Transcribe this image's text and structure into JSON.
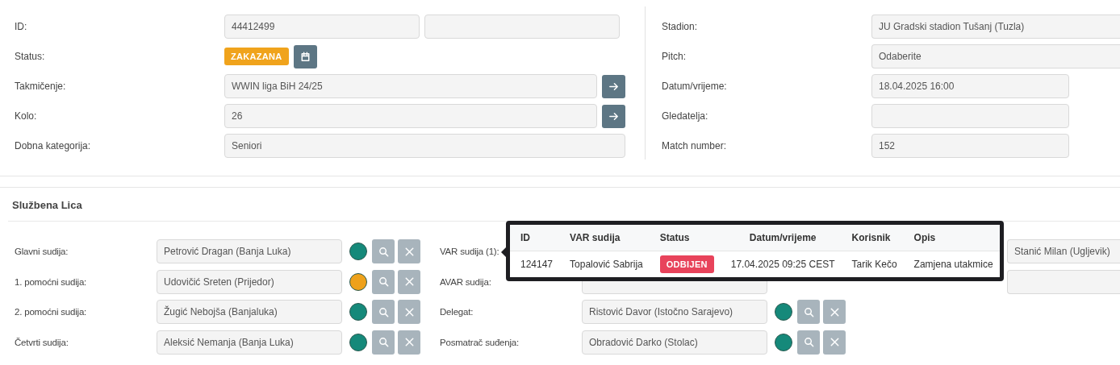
{
  "match": {
    "left": [
      {
        "kind": "double",
        "label": "ID:",
        "value": "44412499"
      },
      {
        "kind": "status",
        "label": "Status:",
        "badge": "ZAKAZANA"
      },
      {
        "kind": "link",
        "label": "Takmičenje:",
        "value": "WWIN liga BiH 24/25"
      },
      {
        "kind": "link",
        "label": "Kolo:",
        "value": "26"
      },
      {
        "kind": "plain",
        "label": "Dobna kategorija:",
        "value": "Seniori"
      }
    ],
    "right": [
      {
        "kind": "wide",
        "label": "Stadion:",
        "value": "JU Gradski stadion Tušanj (Tuzla)"
      },
      {
        "kind": "wide",
        "label": "Pitch:",
        "value": "Odaberite"
      },
      {
        "kind": "plain",
        "label": "Datum/vrijeme:",
        "value": "18.04.2025 16:00"
      },
      {
        "kind": "plain",
        "label": "Gledatelja:"
      },
      {
        "kind": "plain",
        "label": "Match number:",
        "value": "152"
      }
    ]
  },
  "officials": {
    "title": "Službena Lica",
    "columns": [
      [
        {
          "label": "Glavni sudija:",
          "value": "Petrović Dragan (Banja Luka)",
          "color": "#15897a"
        },
        {
          "label": "1. pomoćni sudija:",
          "value": "Udovičić Sreten (Prijedor)",
          "color": "#eea11b"
        },
        {
          "label": "2. pomoćni sudija:",
          "value": "Žugić Nebojša (Banjaluka)",
          "color": "#15897a"
        },
        {
          "label": "Četvrti sudija:",
          "value": "Aleksić Nemanja (Banja Luka)",
          "color": "#15897a"
        }
      ],
      [
        {
          "label": "VAR sudija (1):"
        },
        {
          "label": "AVAR sudija:",
          "kind": "field"
        },
        {
          "label": "Delegat:",
          "value": "Ristović Davor (Istočno Sarajevo)",
          "color": "#15897a"
        },
        {
          "label": "Posmatrač suđenja:",
          "value": "Obradović Darko (Stolac)",
          "color": "#15897a"
        }
      ],
      [
        {
          "value": "Stanić Milan (Ugljevik)"
        },
        {
          "kind": "field"
        }
      ]
    ]
  },
  "popover": {
    "columns": [
      "ID",
      "VAR sudija",
      "Status",
      "Datum/vrijeme",
      "Korisnik",
      "Opis"
    ],
    "rows": [
      {
        "id": "124147",
        "var_sudija": "Topalović Sabrija",
        "status": "ODBIJEN",
        "datum": "17.04.2025 09:25 CEST",
        "korisnik": "Tarik Kečo",
        "opis": "Zamjena utakmice"
      }
    ]
  }
}
